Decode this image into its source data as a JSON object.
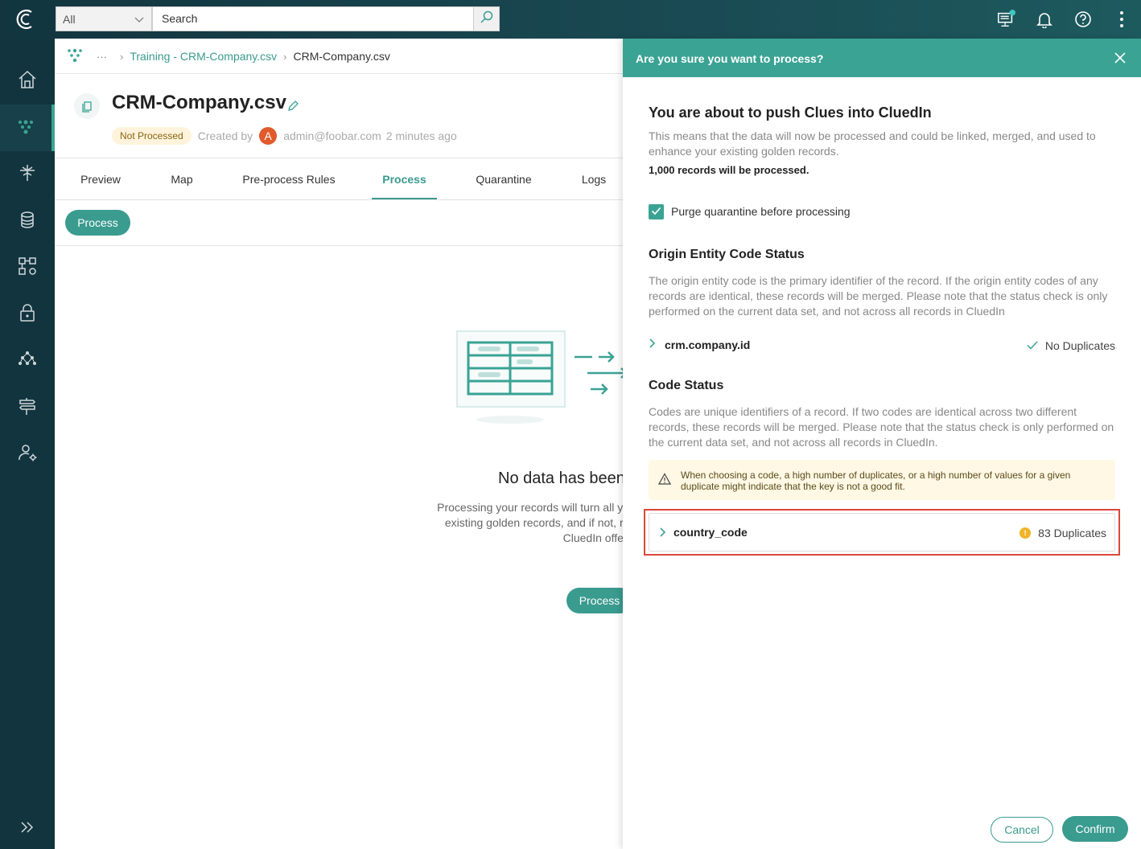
{
  "topbar": {
    "scope_value": "All",
    "search_placeholder": "Search"
  },
  "breadcrumb": {
    "ellipsis": "···",
    "parent": "Training - CRM-Company.csv",
    "current": "CRM-Company.csv"
  },
  "page": {
    "title": "CRM-Company.csv",
    "status_badge": "Not Processed",
    "created_by_label": "Created by",
    "avatar_initial": "A",
    "author": "admin@foobar.com",
    "time_ago": "2 minutes ago"
  },
  "tabs": [
    {
      "label": "Preview"
    },
    {
      "label": "Map"
    },
    {
      "label": "Pre-process Rules"
    },
    {
      "label": "Process"
    },
    {
      "label": "Quarantine"
    },
    {
      "label": "Logs"
    }
  ],
  "toolbar": {
    "process_label": "Process"
  },
  "empty_state": {
    "title": "No data has been",
    "text": "Processing your records will turn all y will analyse these clues to see if th existing golden records, and if not, records. Once processed, you can CluedIn offers to gove",
    "button_label": "Process"
  },
  "drawer": {
    "header": "Are you sure you want to process?",
    "heading": "You are about to push Clues into CluedIn",
    "intro": "This means that the data will now be processed and could be linked, merged, and used to enhance your existing golden records.",
    "records_note": "1,000 records will be processed.",
    "purge_label": "Purge quarantine before processing",
    "origin_section": {
      "title": "Origin Entity Code Status",
      "description": "The origin entity code is the primary identifier of the record. If the origin entity codes of any records are identical, these records will be merged. Please note that the status check is only performed on the current data set, and not across all records in CluedIn",
      "code": "crm.company.id",
      "status": "No Duplicates"
    },
    "code_section": {
      "title": "Code Status",
      "description": "Codes are unique identifiers of a record. If two codes are identical across two different records, these records will be merged. Please note that the status check is only performed on the current data set, and not across all records in CluedIn.",
      "warning": "When choosing a code, a high number of duplicates, or a high number of values for a given duplicate might indicate that the key is not a good fit.",
      "code": "country_code",
      "status": "83 Duplicates",
      "dot_glyph": "!"
    },
    "cancel_label": "Cancel",
    "confirm_label": "Confirm"
  },
  "colors": {
    "accent": "#3aa394",
    "nav_bg": "#12343e",
    "highlight": "#d9483b",
    "warning_bg": "#fff8e4"
  }
}
